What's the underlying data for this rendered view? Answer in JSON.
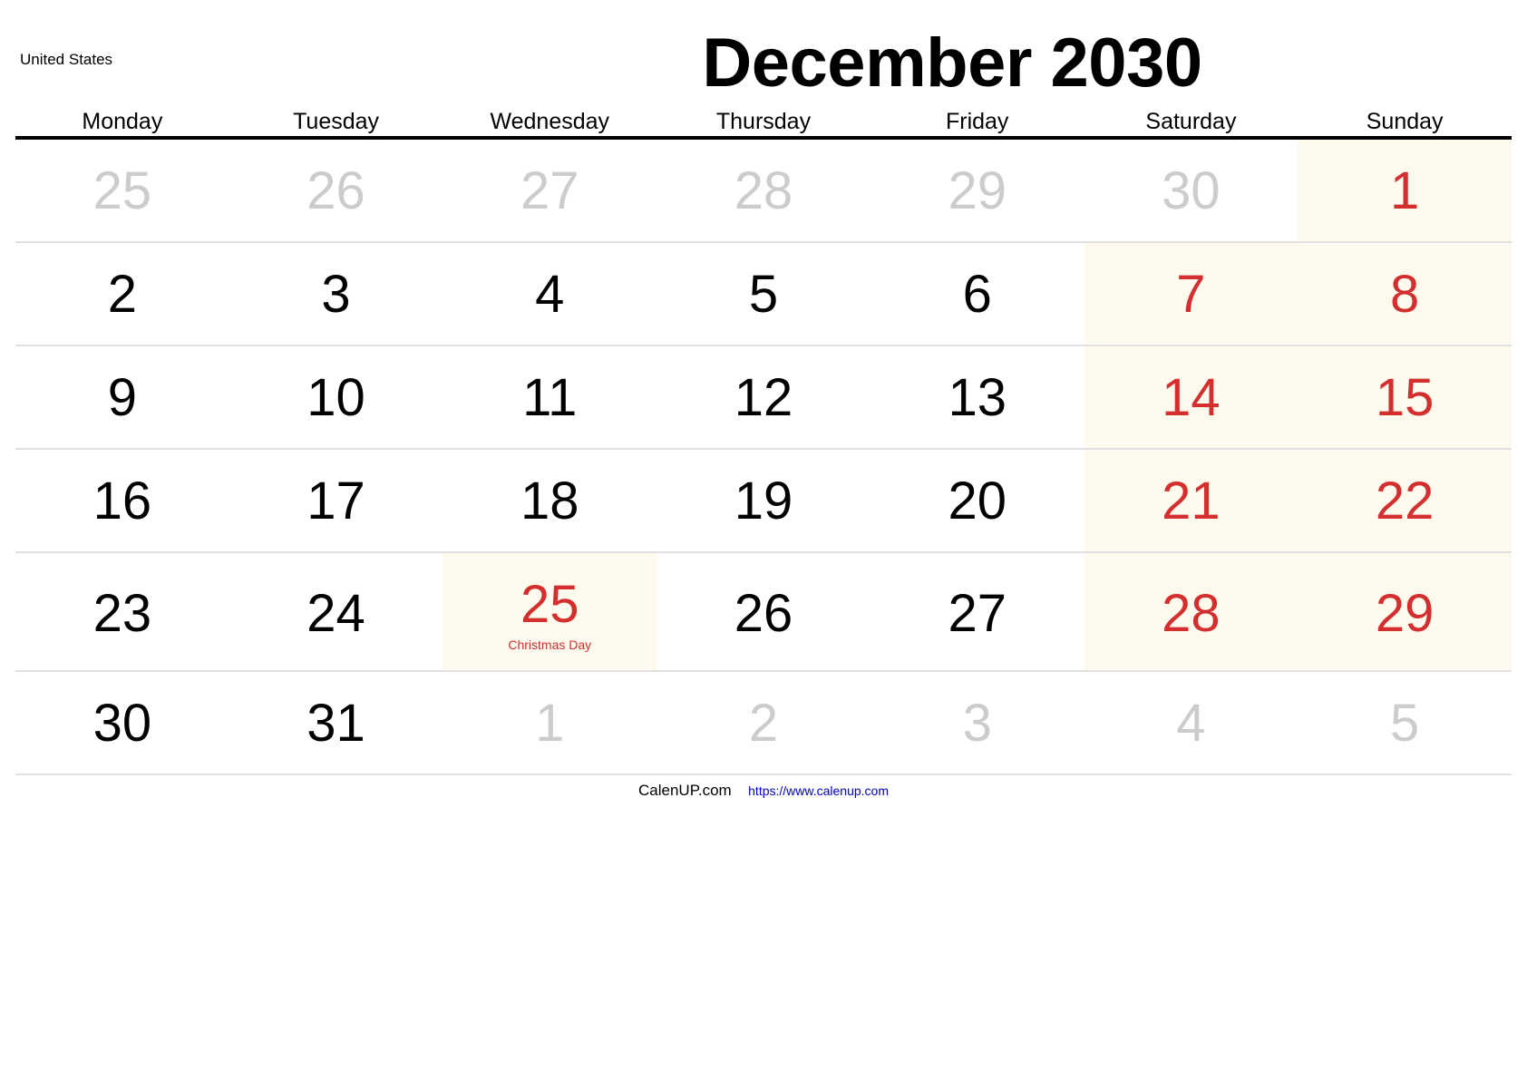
{
  "country": "United States",
  "title": "December 2030",
  "weekdays": [
    "Monday",
    "Tuesday",
    "Wednesday",
    "Thursday",
    "Friday",
    "Saturday",
    "Sunday"
  ],
  "weeks": [
    [
      {
        "day": "25",
        "type": "other"
      },
      {
        "day": "26",
        "type": "other"
      },
      {
        "day": "27",
        "type": "other"
      },
      {
        "day": "28",
        "type": "other"
      },
      {
        "day": "29",
        "type": "other"
      },
      {
        "day": "30",
        "type": "other"
      },
      {
        "day": "1",
        "type": "weekend"
      }
    ],
    [
      {
        "day": "2",
        "type": "current"
      },
      {
        "day": "3",
        "type": "current"
      },
      {
        "day": "4",
        "type": "current"
      },
      {
        "day": "5",
        "type": "current"
      },
      {
        "day": "6",
        "type": "current"
      },
      {
        "day": "7",
        "type": "weekend"
      },
      {
        "day": "8",
        "type": "weekend"
      }
    ],
    [
      {
        "day": "9",
        "type": "current"
      },
      {
        "day": "10",
        "type": "current"
      },
      {
        "day": "11",
        "type": "current"
      },
      {
        "day": "12",
        "type": "current"
      },
      {
        "day": "13",
        "type": "current"
      },
      {
        "day": "14",
        "type": "weekend"
      },
      {
        "day": "15",
        "type": "weekend"
      }
    ],
    [
      {
        "day": "16",
        "type": "current"
      },
      {
        "day": "17",
        "type": "current"
      },
      {
        "day": "18",
        "type": "current"
      },
      {
        "day": "19",
        "type": "current"
      },
      {
        "day": "20",
        "type": "current"
      },
      {
        "day": "21",
        "type": "weekend"
      },
      {
        "day": "22",
        "type": "weekend"
      }
    ],
    [
      {
        "day": "23",
        "type": "current"
      },
      {
        "day": "24",
        "type": "current"
      },
      {
        "day": "25",
        "type": "holiday",
        "holiday": "Christmas Day"
      },
      {
        "day": "26",
        "type": "current"
      },
      {
        "day": "27",
        "type": "current"
      },
      {
        "day": "28",
        "type": "weekend"
      },
      {
        "day": "29",
        "type": "weekend"
      }
    ],
    [
      {
        "day": "30",
        "type": "current"
      },
      {
        "day": "31",
        "type": "current"
      },
      {
        "day": "1",
        "type": "other"
      },
      {
        "day": "2",
        "type": "other"
      },
      {
        "day": "3",
        "type": "other"
      },
      {
        "day": "4",
        "type": "other"
      },
      {
        "day": "5",
        "type": "other"
      }
    ]
  ],
  "footer": {
    "brand": "CalenUP.com",
    "url": "https://www.calenup.com"
  },
  "colors": {
    "weekend_text": "#d32f2f",
    "weekend_bg": "#fffaee",
    "other_month_text": "#cccccc",
    "link": "#0000cc"
  }
}
